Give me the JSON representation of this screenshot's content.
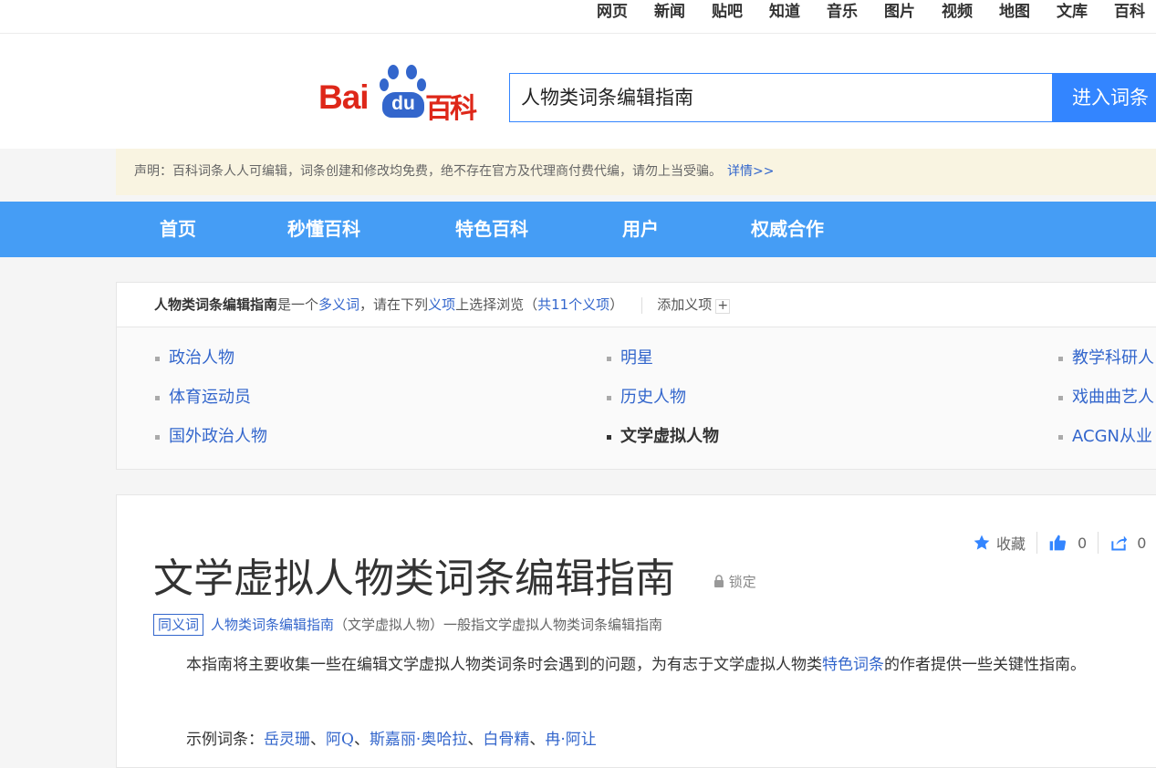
{
  "topnav": [
    "网页",
    "新闻",
    "贴吧",
    "知道",
    "音乐",
    "图片",
    "视频",
    "地图",
    "文库",
    "百科"
  ],
  "logo": {
    "bai": "Bai",
    "du": "du",
    "baike": "百科"
  },
  "search": {
    "value": "人物类词条编辑指南",
    "button": "进入词条"
  },
  "notice": {
    "text": "声明：百科词条人人可编辑，词条创建和修改均免费，绝不存在官方及代理商付费代编，请勿上当受骗。",
    "more": "详情>>"
  },
  "mainnav": [
    "首页",
    "秒懂百科",
    "特色百科",
    "用户",
    "权威合作"
  ],
  "polysemy": {
    "term": "人物类词条编辑指南",
    "is_a": "是一个",
    "poly_word": "多义词",
    "mid": "，请在下列",
    "item_word": "义项",
    "tail": "上选择浏览（",
    "count": "共11个义项",
    "close": "）",
    "add": "添加义项",
    "add_icon": "+",
    "items": [
      "政治人物",
      "明星",
      "教学科研人",
      "体育运动员",
      "历史人物",
      "戏曲曲艺人",
      "国外政治人物",
      "文学虚拟人物",
      "ACGN从业"
    ]
  },
  "article": {
    "title": "文学虚拟人物类词条编辑指南",
    "lock": "锁定",
    "collect": "收藏",
    "likes": "0",
    "shares": "0",
    "syn_tag": "同义词",
    "syn_link": "人物类词条编辑指南",
    "syn_rest": "（文学虚拟人物）一般指文学虚拟人物类词条编辑指南",
    "para_a": "本指南将主要收集一些在编辑文学虚拟人物类词条时会遇到的问题，为有志于文学虚拟人物类",
    "para_link": "特色词条",
    "para_b": "的作者提供一些关键性指南。",
    "examples_label": "示例词条：",
    "examples": [
      "岳灵珊",
      "阿Q",
      "斯嘉丽·奥哈拉",
      "白骨精",
      "冉·阿让"
    ],
    "examples_sep": "、"
  },
  "colors": {
    "brand_red": "#de2719",
    "brand_blue": "#3366cc",
    "nav_blue": "#459df5",
    "search_blue": "#3385ff"
  }
}
